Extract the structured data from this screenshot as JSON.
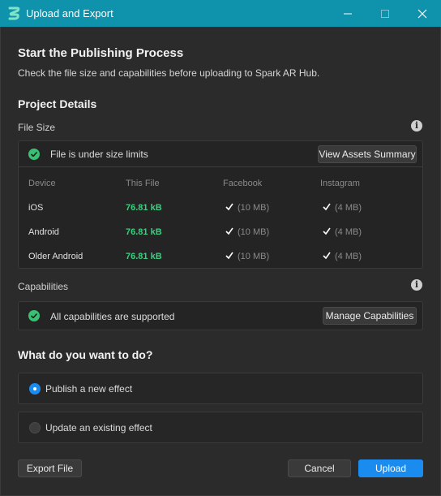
{
  "window": {
    "title": "Upload and Export"
  },
  "page": {
    "title": "Start the Publishing Process",
    "subtitle": "Check the file size and capabilities before uploading to Spark AR Hub."
  },
  "project_details": {
    "heading": "Project Details",
    "file_size": {
      "label": "File Size",
      "status": "File is under size limits",
      "button": "View Assets Summary",
      "columns": [
        "Device",
        "This File",
        "Facebook",
        "Instagram"
      ],
      "rows": [
        {
          "device": "iOS",
          "this_file": "76.81 kB",
          "facebook": "(10 MB)",
          "instagram": "(4 MB)"
        },
        {
          "device": "Android",
          "this_file": "76.81 kB",
          "facebook": "(10 MB)",
          "instagram": "(4 MB)"
        },
        {
          "device": "Older Android",
          "this_file": "76.81 kB",
          "facebook": "(10 MB)",
          "instagram": "(4 MB)"
        }
      ]
    },
    "capabilities": {
      "label": "Capabilities",
      "status": "All capabilities are supported",
      "button": "Manage Capabilities"
    }
  },
  "action": {
    "heading": "What do you want to do?",
    "options": [
      {
        "label": "Publish a new effect",
        "selected": true
      },
      {
        "label": "Update an existing effect",
        "selected": false
      }
    ]
  },
  "footer": {
    "export": "Export File",
    "cancel": "Cancel",
    "upload": "Upload"
  },
  "colors": {
    "titlebar": "#0f93ad",
    "accent": "#1a8cf0",
    "success": "#38c172",
    "size_text": "#38d07e"
  }
}
